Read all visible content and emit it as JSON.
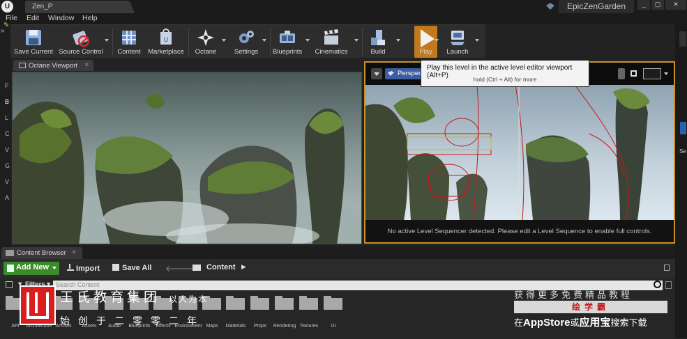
{
  "window": {
    "tab_title": "Zen_P",
    "project_name": "EpicZenGarden",
    "controls": [
      "▢",
      "▢",
      "✕"
    ]
  },
  "menu": [
    "File",
    "Edit",
    "Window",
    "Help"
  ],
  "toolbar": {
    "buttons": [
      {
        "label": "Save Current",
        "icon": "save-icon"
      },
      {
        "label": "Source Control",
        "icon": "source-control-icon"
      },
      {
        "label": "Content",
        "icon": "content-icon"
      },
      {
        "label": "Marketplace",
        "icon": "marketplace-icon"
      },
      {
        "label": "Octane",
        "icon": "octane-icon"
      },
      {
        "label": "Settings",
        "icon": "settings-icon"
      },
      {
        "label": "Blueprints",
        "icon": "blueprints-icon"
      },
      {
        "label": "Cinematics",
        "icon": "cinematics-icon"
      },
      {
        "label": "Build",
        "icon": "build-icon"
      },
      {
        "label": "Play",
        "icon": "play-icon"
      },
      {
        "label": "Launch",
        "icon": "launch-icon"
      }
    ]
  },
  "left_letters": [
    "F",
    "B",
    "L",
    "C",
    "V",
    "G",
    "V",
    "A"
  ],
  "octane_viewport": {
    "tab_label": "Octane Viewport"
  },
  "level_viewport": {
    "view_mode": "Perspec",
    "status_message": "No active Level Sequencer detected. Please edit a Level Sequence to enable full controls."
  },
  "tooltip": {
    "title": "Play this level in the active level editor viewport (Alt+P)",
    "subtitle": "hold (Ctrl + Alt) for more"
  },
  "right_panel": {
    "labels": [
      "Se"
    ]
  },
  "content_browser": {
    "tab_label": "Content Browser",
    "add_new_label": "Add New",
    "import_label": "Import",
    "save_all_label": "Save All",
    "path_label": "Content",
    "filters_label": "Filters",
    "search_placeholder": "Search Content",
    "folders": [
      "API",
      "Architecture",
      "Archvis",
      "Assets",
      "Audio",
      "Blueprints",
      "Effects",
      "Environment",
      "Maps",
      "Materials",
      "Props",
      "Rendering",
      "Textures",
      "UI"
    ]
  },
  "watermark": {
    "line1": "王氏教育集团",
    "line1b": "以人为本",
    "line2": "始创于二零零二年",
    "right1": "获得更多免费精品教程",
    "right2": "绘学霸",
    "right3_pre": "在",
    "right3_app": "AppStore",
    "right3_mid": "或",
    "right3_store": "应用宝",
    "right3_post": "搜索下载"
  }
}
